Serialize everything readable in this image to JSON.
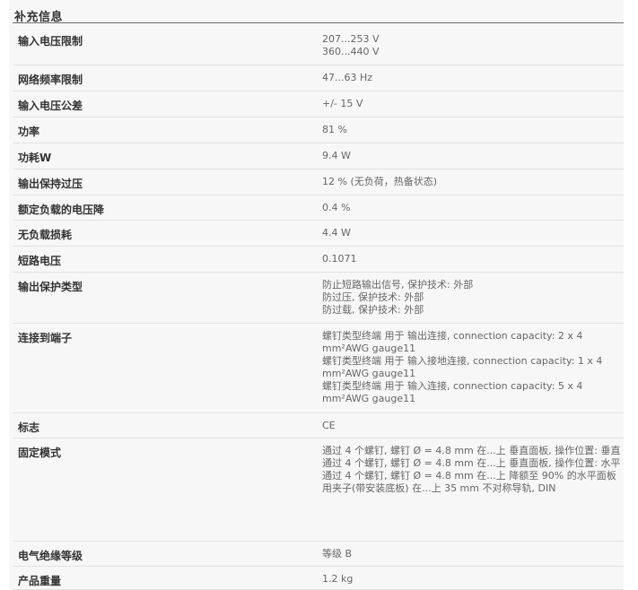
{
  "section_title": "补充信息",
  "rows": [
    {
      "label": "输入电压限制",
      "lines": [
        "207...253 V",
        "360...440 V"
      ]
    },
    {
      "label": "网络频率限制",
      "lines": [
        "47...63 Hz"
      ]
    },
    {
      "label": "输入电压公差",
      "lines": [
        "+/- 15 V"
      ]
    },
    {
      "label": "功率",
      "lines": [
        "81 %"
      ]
    },
    {
      "label": "功耗W",
      "lines": [
        "9.4 W"
      ]
    },
    {
      "label": "输出保持过压",
      "lines": [
        "12 % (无负荷，热备状态)"
      ]
    },
    {
      "label": "额定负载的电压降",
      "lines": [
        "0.4 %"
      ]
    },
    {
      "label": "无负载损耗",
      "lines": [
        "4.4 W"
      ]
    },
    {
      "label": "短路电压",
      "lines": [
        "0.1071"
      ]
    },
    {
      "label": "输出保护类型",
      "lines": [
        "防止短路输出信号, 保护技术: 外部",
        "防过压, 保护技术: 外部",
        "防过载, 保护技术: 外部"
      ]
    },
    {
      "label": "连接到端子",
      "lines": [
        "螺钉类型终端 用于 输出连接, connection capacity: 2 x 4 mm²AWG gauge11",
        "螺钉类型终端 用于 输入接地连接, connection capacity: 1 x 4 mm²AWG gauge11",
        "螺钉类型终端 用于 输入连接, connection capacity: 5 x 4 mm²AWG gauge11"
      ]
    },
    {
      "label": "标志",
      "lines": [
        "CE"
      ]
    },
    {
      "label": "固定模式",
      "lines": [
        "通过 4 个螺钉, 螺钉 Ø = 4.8 mm 在...上 垂直面板, 操作位置: 垂直",
        "通过 4 个螺钉, 螺钉 Ø = 4.8 mm 在...上 垂直面板, 操作位置: 水平",
        "通过 4 个螺钉, 螺钉 Ø = 4.8 mm 在...上 降额至 90% 的水平面板",
        "用夹子(带安装底板) 在...上 35 mm 不对称导轨, DIN"
      ]
    },
    {
      "label": "电气绝缘等级",
      "lines": [
        "等级 B"
      ]
    },
    {
      "label": "产品重量",
      "lines": [
        "1.2 kg"
      ]
    }
  ]
}
